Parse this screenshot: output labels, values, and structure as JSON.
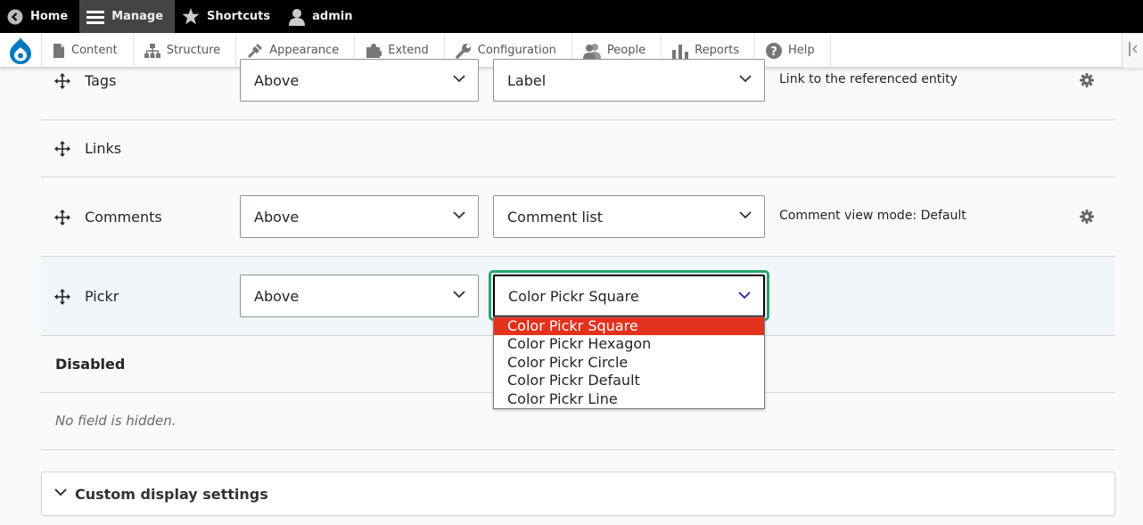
{
  "toolbar": {
    "home": "Home",
    "manage": "Manage",
    "shortcuts": "Shortcuts",
    "user": "admin"
  },
  "tray": {
    "items": [
      "Content",
      "Structure",
      "Appearance",
      "Extend",
      "Configuration",
      "People",
      "Reports",
      "Help"
    ]
  },
  "rows": {
    "tags": {
      "label": "Tags",
      "label_display": "Above",
      "format": "Label",
      "summary": "Link to the referenced entity"
    },
    "links": {
      "label": "Links"
    },
    "comments": {
      "label": "Comments",
      "label_display": "Above",
      "format": "Comment list",
      "summary": "Comment view mode: Default"
    },
    "pickr": {
      "label": "Pickr",
      "label_display": "Above",
      "format": "Color Pickr Square"
    }
  },
  "dropdown": {
    "options": [
      "Color Pickr Square",
      "Color Pickr Hexagon",
      "Color Pickr Circle",
      "Color Pickr Default",
      "Color Pickr Line"
    ],
    "selected_index": 0
  },
  "disabled": {
    "heading": "Disabled",
    "empty_text": "No field is hidden."
  },
  "custom_display": {
    "title": "Custom display settings"
  },
  "colors": {
    "focus": "#26a769",
    "selected_option": "#e3321c",
    "drupal_blue": "#0678be"
  }
}
